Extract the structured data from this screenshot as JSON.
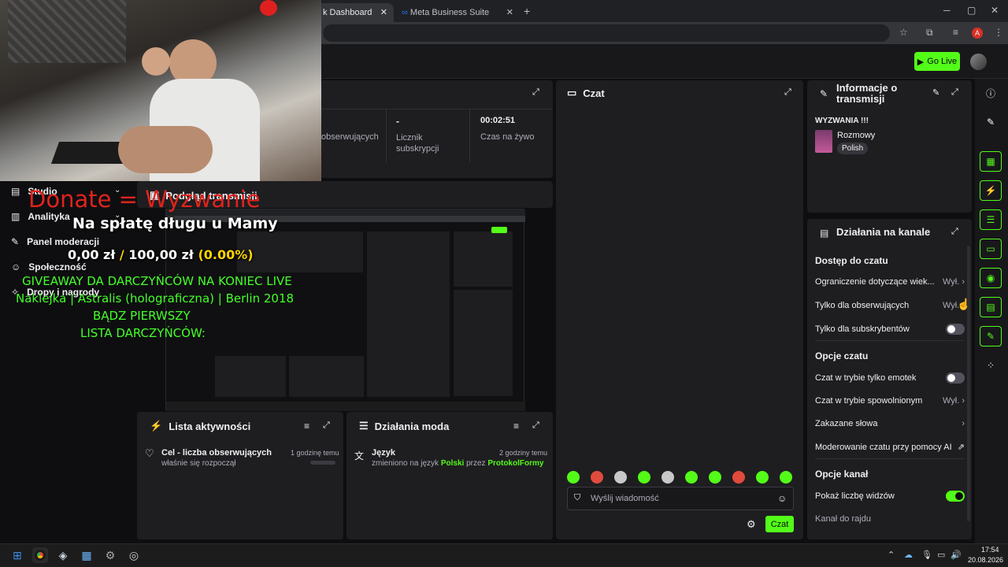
{
  "browser": {
    "tabs": [
      {
        "label": "k Dashboard"
      },
      {
        "label": "Meta Business Suite"
      }
    ]
  },
  "header": {
    "go_live": "Go Live"
  },
  "stats": {
    "followers_label": "obserwujących",
    "subs_value": "-",
    "subs_label": "Licznik subskrypcji",
    "time_value": "00:02:51",
    "time_label": "Czas na żywo"
  },
  "left_nav": {
    "items": [
      {
        "label": "Studio"
      },
      {
        "label": "Analityka"
      },
      {
        "label": "Panel moderacji"
      },
      {
        "label": "Społeczność"
      },
      {
        "label": "Dropy i nagrody"
      }
    ]
  },
  "preview": {
    "title": "Podgląd transmisji"
  },
  "overlay": {
    "donate_line": "Donate = Wyzwanie",
    "goal_title": "Na spłatę długu u Mamy",
    "goal_current": "0,00 zł",
    "goal_sep": "/",
    "goal_target": "100,00 zł",
    "goal_percent": "(0.00%)",
    "giveaway": "GIVEAWAY DA DARCZYŃCÓW NA KONIEC LIVE",
    "sticker": "Naklejka | Astralis (holograficzna) | Berlin 2018",
    "be_first": "BĄDZ PIERWSZY",
    "donors": "LISTA DARCZYŃCÓW:"
  },
  "activity": {
    "title": "Lista aktywności",
    "item_title": "Cel - liczba obserwujących",
    "item_sub": "właśnie się rozpoczął",
    "item_time": "1 godzinę temu"
  },
  "modactions": {
    "title": "Działania moda",
    "item_title": "Język",
    "item_prefix": "zmieniono na język",
    "item_lang": "Polski",
    "item_by": "przez",
    "item_user": "ProtokolFormy",
    "item_time": "2 godziny temu"
  },
  "chat": {
    "title": "Czat",
    "placeholder": "Wyślij wiadomość",
    "send": "Czat"
  },
  "stream_info": {
    "title": "Informacje o transmisji",
    "stream_title": "WYZWANIA !!!",
    "category": "Rozmowy",
    "tag": "Polish"
  },
  "channel_actions": {
    "title": "Działania na kanale",
    "section_access": "Dostęp do czatu",
    "age_limit": "Ograniczenie dotyczące wiek...",
    "age_value": "Wył.",
    "followers_only": "Tylko dla obserwujących",
    "followers_value": "Wył.",
    "subs_only": "Tylko dla subskrybentów",
    "subs_only_on": false,
    "section_options": "Opcje czatu",
    "emote_only": "Czat w trybie tylko emotek",
    "emote_only_on": false,
    "slow_mode": "Czat w trybie spowolnionym",
    "slow_value": "Wył.",
    "banned_words": "Zakazane słowa",
    "ai_mod": "Moderowanie czatu przy pomocy AI",
    "section_channel": "Opcje kanał",
    "viewer_count": "Pokaż liczbę widzów",
    "viewer_count_on": true,
    "raid_channel": "Kanał do rajdu"
  },
  "taskbar": {
    "time": "17:54",
    "date": "20.08.2026"
  },
  "colors": {
    "accent": "#53fc18",
    "panel": "#1e1e21",
    "bg": "#0e0e10",
    "overlay_red": "#e0231c"
  }
}
